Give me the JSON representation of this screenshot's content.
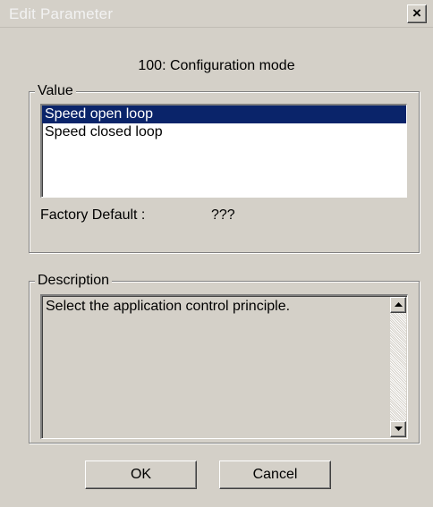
{
  "window": {
    "title": "Edit Parameter",
    "close_label": "×"
  },
  "parameter": {
    "heading": "100: Configuration mode"
  },
  "value_group": {
    "legend": "Value",
    "options": [
      {
        "label": "Speed open loop",
        "selected": true
      },
      {
        "label": "Speed closed loop",
        "selected": false
      }
    ],
    "factory_default_label": "Factory Default :",
    "factory_default_value": "???"
  },
  "description_group": {
    "legend": "Description",
    "text": "Select the application control principle."
  },
  "buttons": {
    "ok_label": "OK",
    "cancel_label": "Cancel"
  },
  "colors": {
    "selection": "#0a246a",
    "face": "#d4d0c8"
  }
}
